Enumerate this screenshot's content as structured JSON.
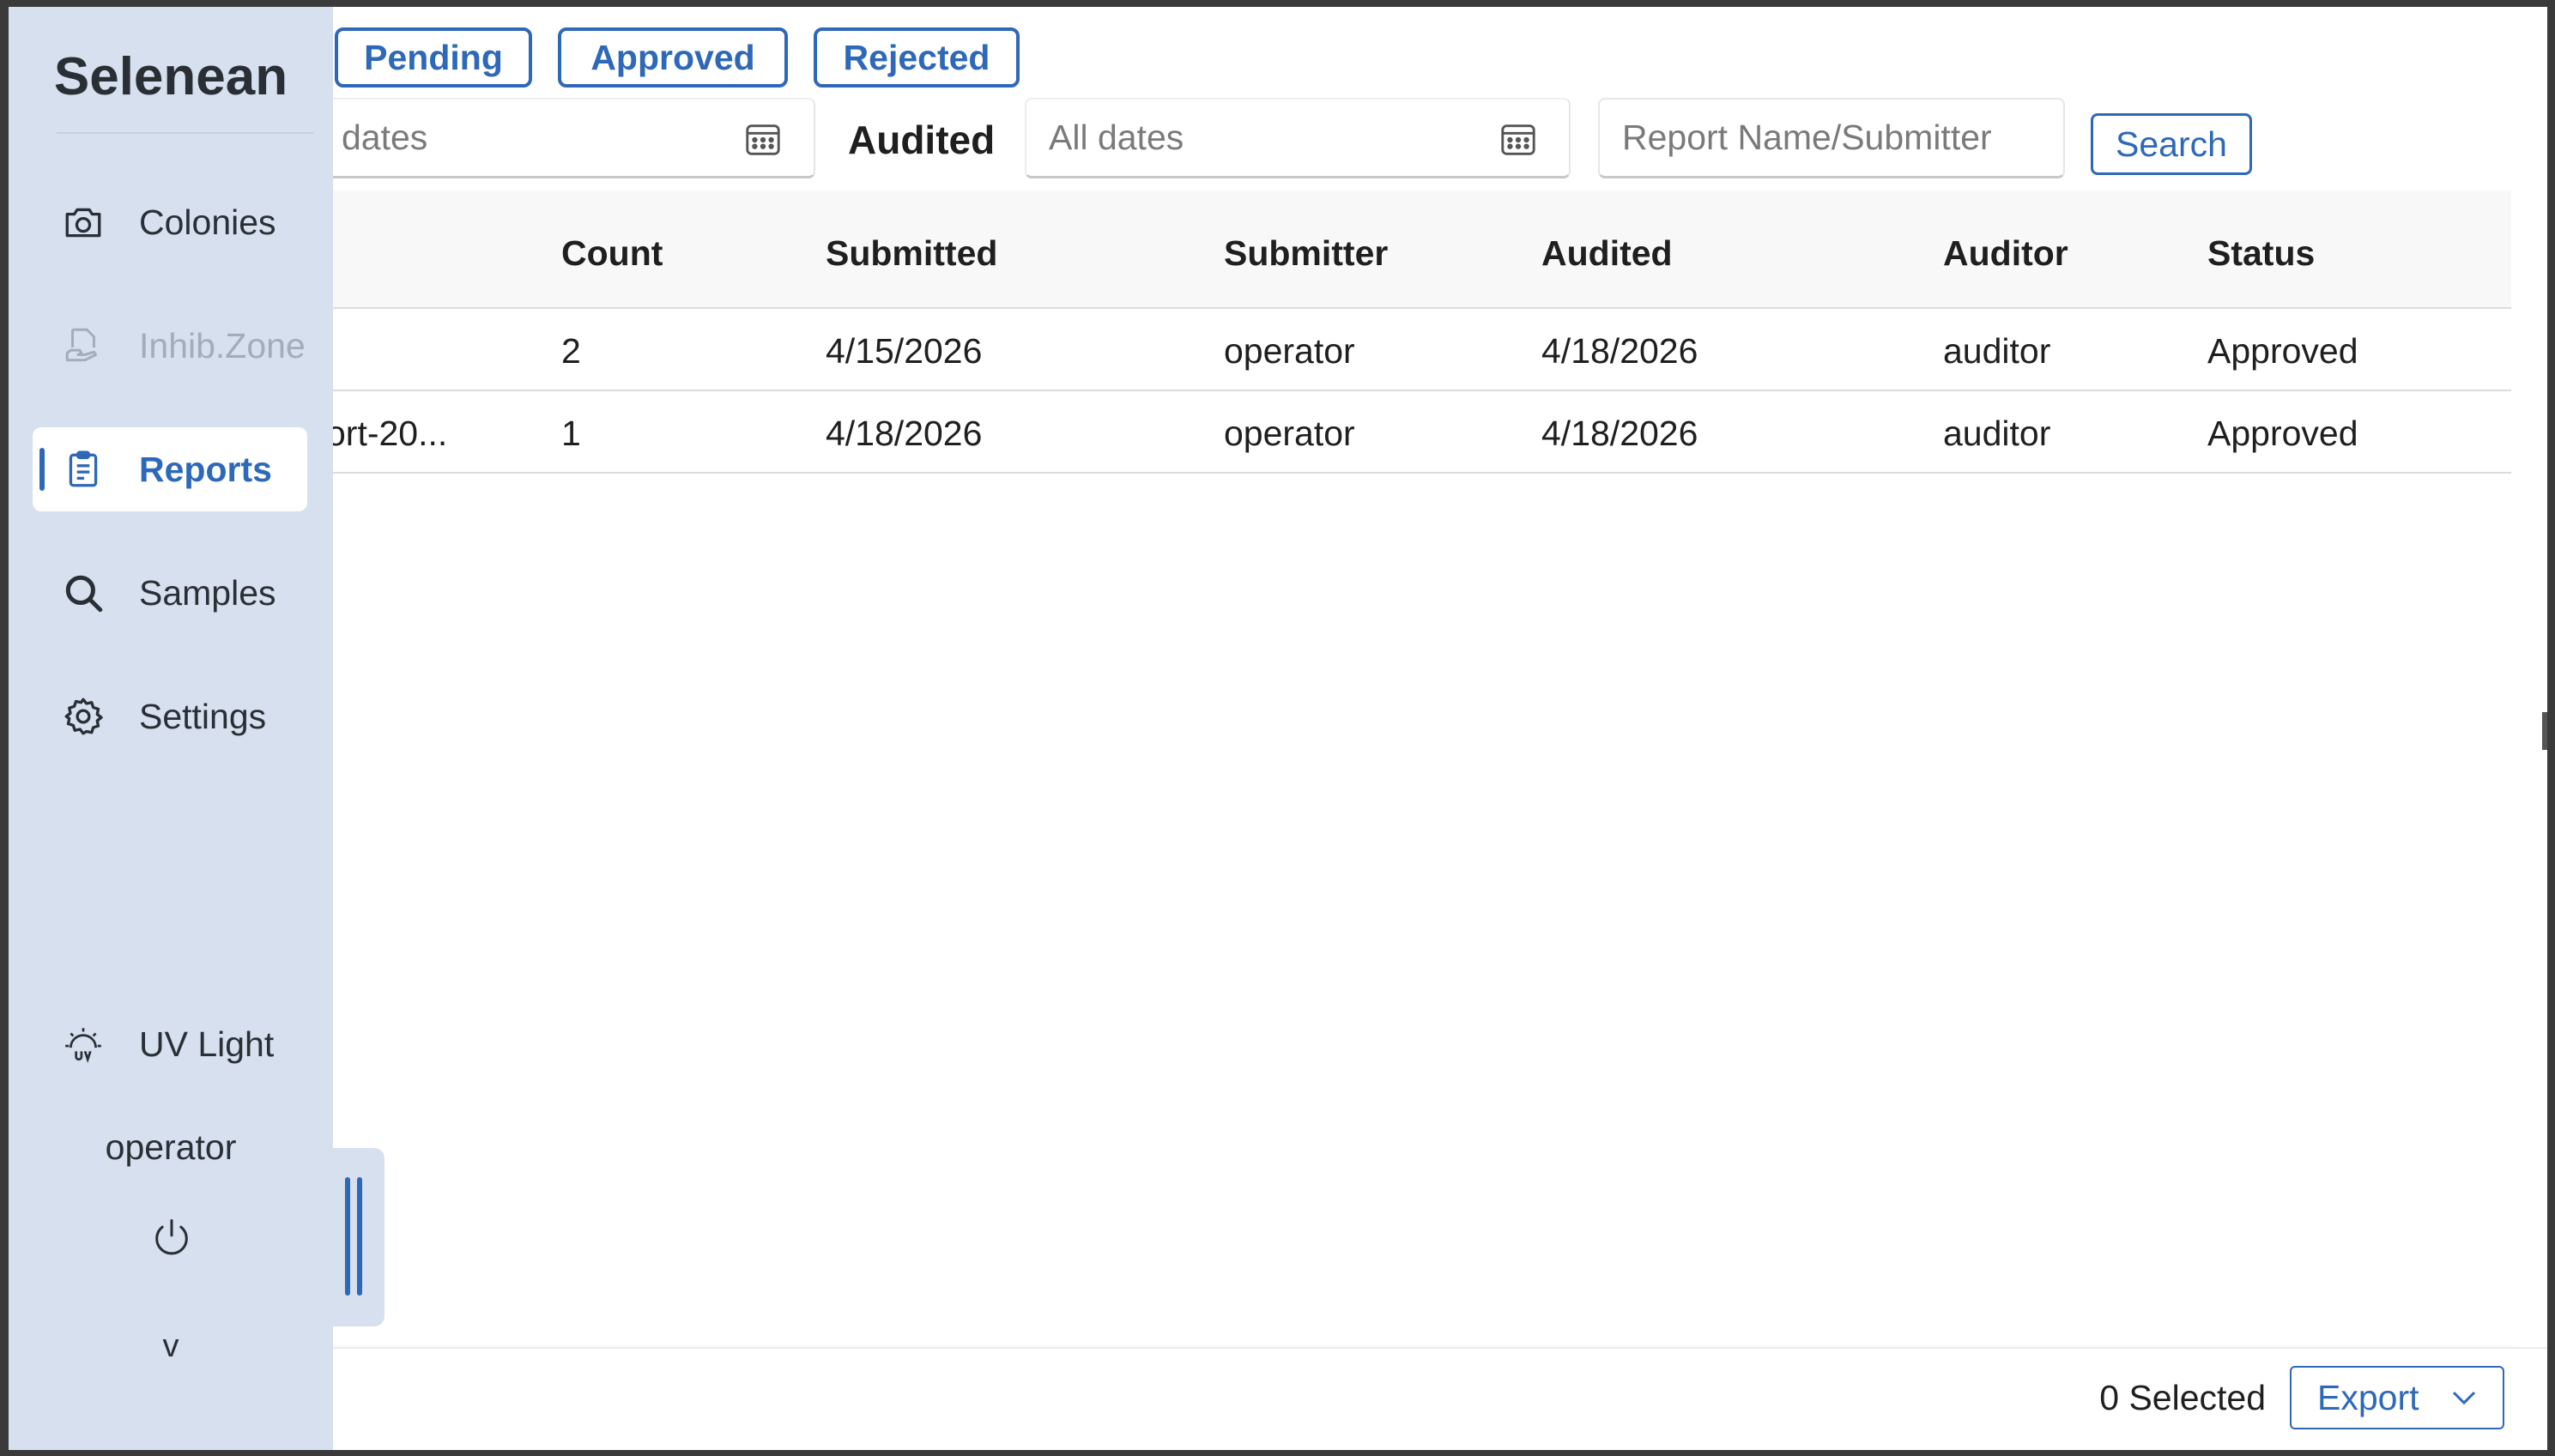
{
  "app": {
    "name": "Selenean"
  },
  "status_tabs": [
    {
      "label": "Pending"
    },
    {
      "label": "Approved"
    },
    {
      "label": "Rejected"
    }
  ],
  "filters": {
    "submitted_date_visible_text": "dates",
    "audited_label": "Audited",
    "audited_date_placeholder": "All dates",
    "search_placeholder": "Report Name/Submitter",
    "search_button": "Search"
  },
  "table": {
    "columns": [
      "Count",
      "Submitted",
      "Submitter",
      "Audited",
      "Auditor",
      "Status"
    ],
    "rows": [
      {
        "name": "",
        "count": "2",
        "submitted": "4/15/2026",
        "submitter": "operator",
        "audited": "4/18/2026",
        "auditor": "auditor",
        "status": "Approved"
      },
      {
        "name": "ort-20...",
        "count": "1",
        "submitted": "4/18/2026",
        "submitter": "operator",
        "audited": "4/18/2026",
        "auditor": "auditor",
        "status": "Approved"
      }
    ]
  },
  "footer": {
    "selected": "0 Selected",
    "export": "Export"
  },
  "sidebar": {
    "items": [
      {
        "label": "Colonies",
        "icon": "camera-icon",
        "state": "normal"
      },
      {
        "label": "Inhib.Zone",
        "icon": "document-hand-icon",
        "state": "disabled"
      },
      {
        "label": "Reports",
        "icon": "clipboard-icon",
        "state": "active"
      },
      {
        "label": "Samples",
        "icon": "search-icon",
        "state": "normal"
      },
      {
        "label": "Settings",
        "icon": "gear-icon",
        "state": "normal"
      }
    ],
    "uv_light": {
      "label": "UV Light",
      "icon": "uv-light-icon"
    },
    "user": "operator",
    "version": "v"
  },
  "colors": {
    "accent": "#2e68b8",
    "sidebar_bg": "#d6e0ee",
    "header_bg": "#f8f8f8"
  }
}
